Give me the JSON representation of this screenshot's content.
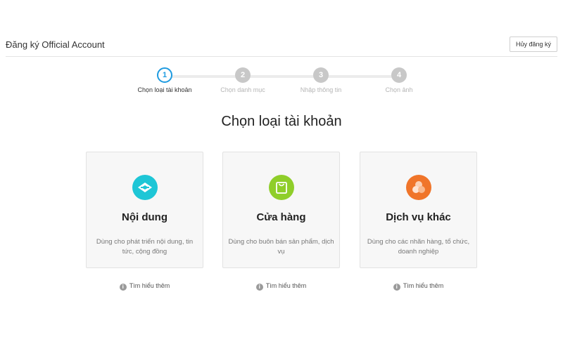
{
  "header": {
    "title": "Đăng ký Official Account",
    "cancel_label": "Hủy đăng ký"
  },
  "steps": [
    {
      "number": "1",
      "label": "Chọn loại tài khoản",
      "state": "active"
    },
    {
      "number": "2",
      "label": "Chọn danh mục",
      "state": "inactive"
    },
    {
      "number": "3",
      "label": "Nhập thông tin",
      "state": "inactive"
    },
    {
      "number": "4",
      "label": "Chọn ảnh",
      "state": "inactive"
    }
  ],
  "main": {
    "title": "Chọn loại tài khoản",
    "cards": [
      {
        "title": "Nội dung",
        "desc": "Dùng cho phát triển nội dung, tin tức, cộng đồng",
        "icon": "content-icon",
        "color": "#1ec6d6"
      },
      {
        "title": "Cửa hàng",
        "desc": "Dùng cho buôn bán sản phẩm, dịch vụ",
        "icon": "shopping-bag-icon",
        "color": "#8fce2a"
      },
      {
        "title": "Dịch vụ khác",
        "desc": "Dùng cho các nhãn hàng, tổ chức, doanh nghiệp",
        "icon": "circles-icon",
        "color": "#f0752a"
      }
    ],
    "learn_more": "Tìm hiểu thêm",
    "info_glyph": "i"
  },
  "colors": {
    "accent": "#1e9be0",
    "inactive_step": "#c8c8c8"
  }
}
